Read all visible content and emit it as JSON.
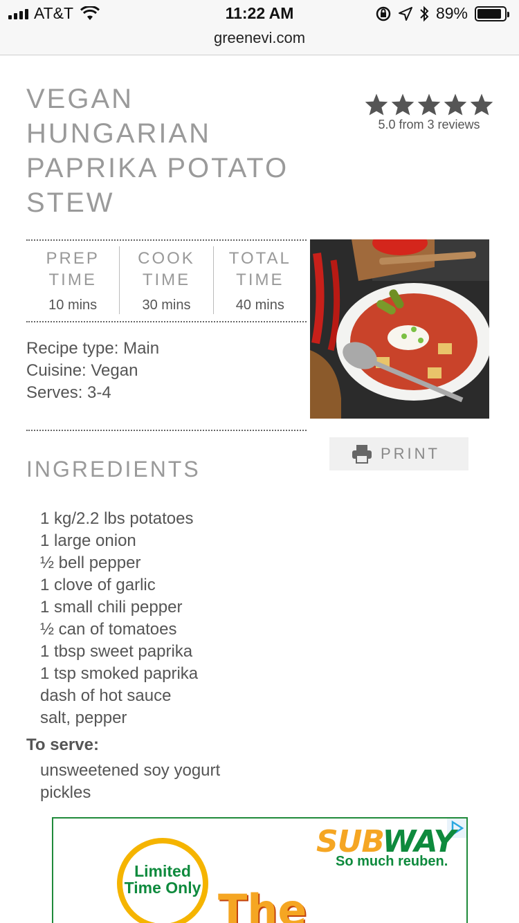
{
  "status_bar": {
    "carrier": "AT&T",
    "time": "11:22 AM",
    "battery_percent": "89%",
    "battery_level": 0.89,
    "url": "greenevi.com"
  },
  "recipe": {
    "title": "VEGAN HUNGARIAN PAPRIKA POTATO STEW",
    "rating": {
      "stars": 5,
      "text": "5.0 from 3 reviews"
    },
    "times": [
      {
        "label": "PREP TIME",
        "value": "10 mins"
      },
      {
        "label": "COOK TIME",
        "value": "30 mins"
      },
      {
        "label": "TOTAL TIME",
        "value": "40 mins"
      }
    ],
    "meta": {
      "recipe_type": "Recipe type: Main",
      "cuisine": "Cuisine: Vegan",
      "serves": "Serves: 3-4"
    },
    "print_label": "PRINT",
    "ingredients_heading": "INGREDIENTS",
    "ingredients": [
      "1 kg/2.2 lbs potatoes",
      "1 large onion",
      "½ bell pepper",
      "1 clove of garlic",
      "1 small chili pepper",
      "½ can of tomatoes",
      "1 tbsp sweet paprika",
      "1 tsp smoked paprika",
      "dash of hot sauce",
      "salt, pepper"
    ],
    "to_serve_heading": "To serve:",
    "to_serve": [
      "unsweetened soy yogurt",
      "pickles"
    ]
  },
  "ad": {
    "brand_part1": "SUB",
    "brand_part2": "WAY",
    "tagline": "So much reuben.",
    "badge_line1": "Limited",
    "badge_line2": "Time Only",
    "headline": "The"
  },
  "colors": {
    "title_gray": "#9a9a9a",
    "body_text": "#555555",
    "star": "#555555",
    "ad_green": "#0e8a3d",
    "ad_yellow": "#f5a623"
  }
}
